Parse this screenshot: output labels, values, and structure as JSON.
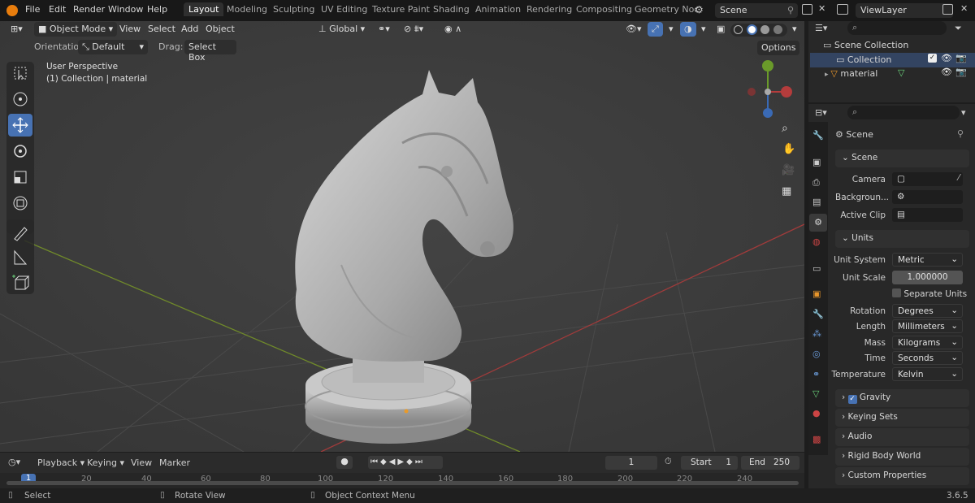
{
  "menu": [
    "File",
    "Edit",
    "Render",
    "Window",
    "Help"
  ],
  "workspaces": [
    "Layout",
    "Modeling",
    "Sculpting",
    "UV Editing",
    "Texture Paint",
    "Shading",
    "Animation",
    "Rendering",
    "Compositing",
    "Geometry Noc"
  ],
  "scene_name": "Scene",
  "view_layer": "ViewLayer",
  "viewport": {
    "mode": "Object Mode",
    "menus": [
      "View",
      "Select",
      "Add",
      "Object"
    ],
    "transform": "Global",
    "orientation_label": "Orientation:",
    "orientation_value": "Default",
    "drag_label": "Drag:",
    "drag_value": "Select Box",
    "options": "Options",
    "overlay_line1": "User Perspective",
    "overlay_line2": "(1) Collection | material"
  },
  "outliner": {
    "root": "Scene Collection",
    "collection": "Collection",
    "object": "material"
  },
  "properties": {
    "title": "Scene",
    "scene_panel": "Scene",
    "camera_label": "Camera",
    "background_label": "Backgroun...",
    "active_clip_label": "Active Clip",
    "units_panel": "Units",
    "unit_system_label": "Unit System",
    "unit_system": "Metric",
    "unit_scale_label": "Unit Scale",
    "unit_scale": "1.000000",
    "separate_units": "Separate Units",
    "rotation_label": "Rotation",
    "rotation": "Degrees",
    "length_label": "Length",
    "length": "Millimeters",
    "mass_label": "Mass",
    "mass": "Kilograms",
    "time_label": "Time",
    "time": "Seconds",
    "temperature_label": "Temperature",
    "temperature": "Kelvin",
    "collapsed_panels": [
      "Gravity",
      "Keying Sets",
      "Audio",
      "Rigid Body World",
      "Custom Properties"
    ]
  },
  "timeline": {
    "menus": [
      "Playback",
      "Keying",
      "View",
      "Marker"
    ],
    "current_frame": "1",
    "start_label": "Start",
    "start": "1",
    "end_label": "End",
    "end": "250",
    "ruler": [
      "1",
      "20",
      "40",
      "60",
      "80",
      "100",
      "120",
      "140",
      "160",
      "180",
      "200",
      "220",
      "240"
    ]
  },
  "status": {
    "select": "Select",
    "rotate": "Rotate View",
    "context": "Object Context Menu",
    "version": "3.6.5"
  }
}
